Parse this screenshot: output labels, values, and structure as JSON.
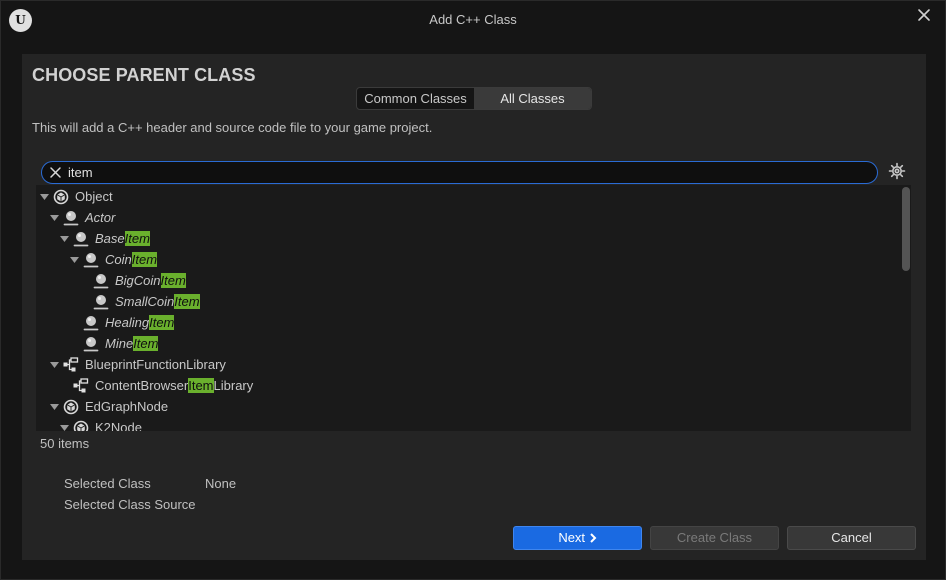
{
  "window": {
    "title": "Add C++ Class",
    "logo_text": "U"
  },
  "header": {
    "heading": "CHOOSE PARENT CLASS",
    "description": "This will add a C++ header and source code file to your game project."
  },
  "tabs": [
    {
      "label": "Common Classes",
      "active": false
    },
    {
      "label": "All Classes",
      "active": true
    }
  ],
  "search": {
    "value": "item",
    "placeholder": ""
  },
  "tree": [
    {
      "segments": [
        "Object"
      ],
      "indent": 0,
      "expanded": true,
      "icon": "object-icon",
      "italic": false
    },
    {
      "segments": [
        "Actor"
      ],
      "indent": 1,
      "expanded": true,
      "icon": "actor-icon",
      "italic": true
    },
    {
      "segments": [
        "Base",
        "Item"
      ],
      "indent": 2,
      "expanded": true,
      "icon": "actor-icon",
      "italic": true
    },
    {
      "segments": [
        "Coin",
        "Item"
      ],
      "indent": 3,
      "expanded": true,
      "icon": "actor-icon",
      "italic": true
    },
    {
      "segments": [
        "BigCoin",
        "Item"
      ],
      "indent": 4,
      "expanded": null,
      "icon": "actor-icon",
      "italic": true
    },
    {
      "segments": [
        "SmallCoin",
        "Item"
      ],
      "indent": 4,
      "expanded": null,
      "icon": "actor-icon",
      "italic": true
    },
    {
      "segments": [
        "Healing",
        "Item"
      ],
      "indent": 3,
      "expanded": null,
      "icon": "actor-icon",
      "italic": true
    },
    {
      "segments": [
        "Mine",
        "Item"
      ],
      "indent": 3,
      "expanded": null,
      "icon": "actor-icon",
      "italic": true
    },
    {
      "segments": [
        "BlueprintFunctionLibrary"
      ],
      "indent": 1,
      "expanded": true,
      "icon": "function-library-icon",
      "italic": false
    },
    {
      "segments": [
        "ContentBrowser",
        "Item",
        "Library"
      ],
      "indent": 2,
      "expanded": null,
      "icon": "function-library-icon",
      "italic": false
    },
    {
      "segments": [
        "EdGraphNode"
      ],
      "indent": 1,
      "expanded": true,
      "icon": "object-icon",
      "italic": false
    },
    {
      "segments": [
        "K2Node"
      ],
      "indent": 2,
      "expanded": true,
      "icon": "object-icon",
      "italic": false
    }
  ],
  "highlight_term": "Item",
  "item_count": "50 items",
  "selected": {
    "class_label": "Selected Class",
    "class_value": "None",
    "source_label": "Selected Class Source",
    "source_value": ""
  },
  "buttons": {
    "next": "Next",
    "create": "Create Class",
    "cancel": "Cancel"
  },
  "colors": {
    "accent": "#1a6ae2",
    "highlight": "#6ab02d",
    "search_border": "#2a6bd4"
  }
}
